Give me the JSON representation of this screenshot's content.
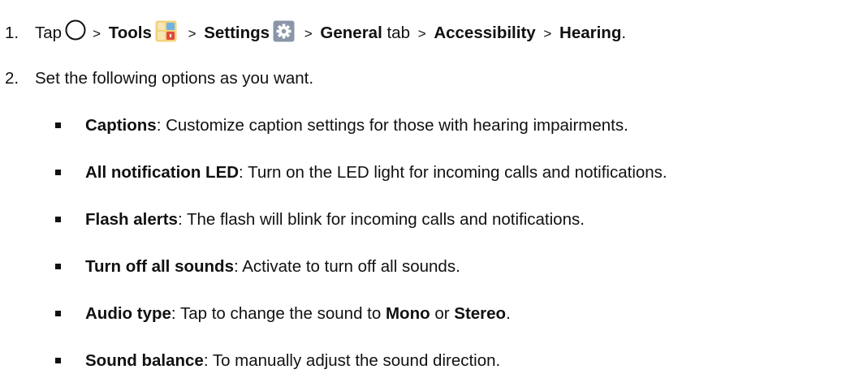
{
  "steps": [
    {
      "number": "1.",
      "tap": "Tap",
      "sep": ">",
      "tools": "Tools",
      "settings": "Settings",
      "general": "General",
      "tab": "tab",
      "accessibility": "Accessibility",
      "hearing": "Hearing",
      "end": "."
    },
    {
      "number": "2.",
      "text": "Set the following options as you want."
    }
  ],
  "options": [
    {
      "term": "Captions",
      "desc": ": Customize caption settings for those with hearing impairments."
    },
    {
      "term": "All notification LED",
      "desc": ": Turn on the LED light for incoming calls and notifications."
    },
    {
      "term": "Flash alerts",
      "desc": ": The flash will blink for incoming calls and notifications."
    },
    {
      "term": "Turn off all sounds",
      "desc": ": Activate to turn off all sounds."
    },
    {
      "term": "Audio type",
      "desc": ": Tap to change the sound to ",
      "mono": "Mono",
      "or": " or ",
      "stereo": "Stereo",
      "end": "."
    },
    {
      "term": "Sound balance",
      "desc": ": To manually adjust the sound direction."
    }
  ],
  "icons": {
    "home": "home-circle-icon",
    "tools": "tools-folder-icon",
    "settings": "settings-gear-icon"
  }
}
